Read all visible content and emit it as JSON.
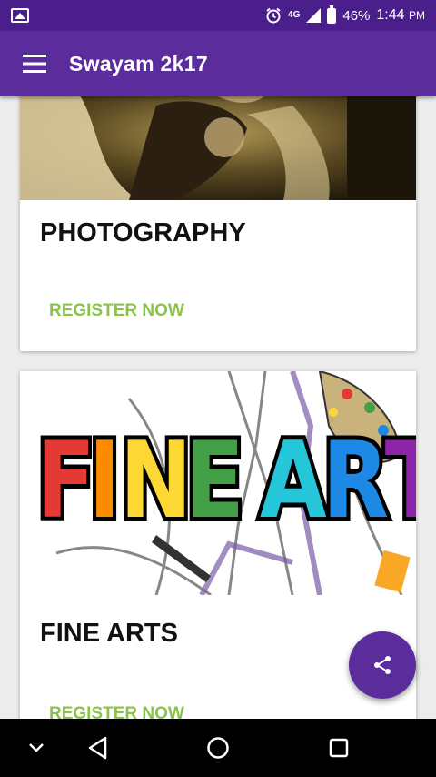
{
  "status_bar": {
    "network": "4G",
    "battery": "46%",
    "time": "1:44",
    "time_suffix": "PM"
  },
  "app_bar": {
    "title": "Swayam 2k17",
    "menu_icon": "hamburger-menu-icon"
  },
  "events": [
    {
      "title": "PHOTOGRAPHY",
      "action": "REGISTER NOW"
    },
    {
      "title": "FINE ARTS",
      "action": "REGISTER NOW",
      "banner_text": "FINE ARTS"
    }
  ],
  "fab": {
    "icon": "share-icon"
  },
  "nav_bar": {
    "icons": [
      "chevron-down-icon",
      "back-icon",
      "home-icon",
      "recents-icon"
    ]
  },
  "colors": {
    "status_bar": "#4a1f8c",
    "app_bar": "#5b2c9c",
    "accent_green": "#8bc34a",
    "fab": "#5b2c9c"
  }
}
